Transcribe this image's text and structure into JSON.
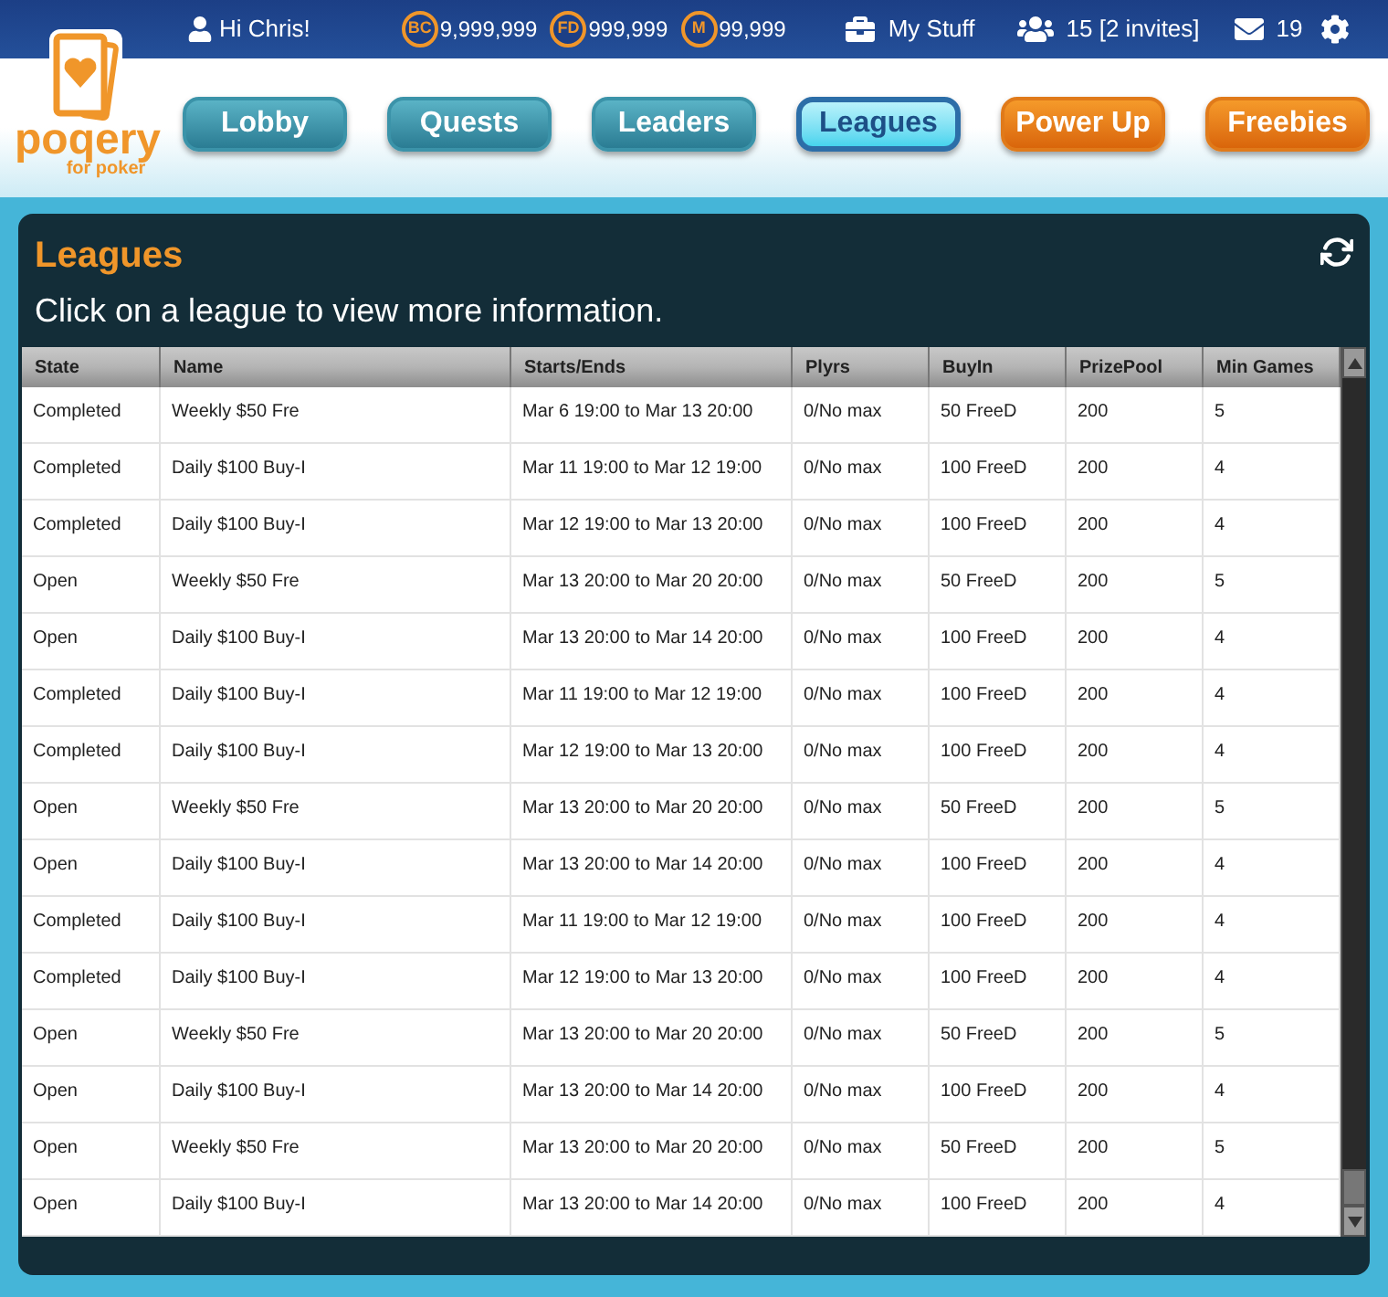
{
  "logo": {
    "name": "poqery",
    "tagline": "for poker"
  },
  "top_bar": {
    "greeting": "Hi Chris!",
    "currencies": [
      {
        "symbol": "BC",
        "amount": "9,999,999"
      },
      {
        "symbol": "FD",
        "amount": "999,999"
      },
      {
        "symbol": "M",
        "amount": "99,999"
      }
    ],
    "my_stuff": "My Stuff",
    "friends": "15 [2 invites]",
    "messages": "19"
  },
  "nav": [
    {
      "label": "Lobby",
      "kind": "teal",
      "selected": false
    },
    {
      "label": "Quests",
      "kind": "teal",
      "selected": false
    },
    {
      "label": "Leaders",
      "kind": "teal",
      "selected": false
    },
    {
      "label": "Leagues",
      "kind": "teal",
      "selected": true
    },
    {
      "label": "Power Up",
      "kind": "orange",
      "selected": false
    },
    {
      "label": "Freebies",
      "kind": "orange",
      "selected": false
    }
  ],
  "panel": {
    "title": "Leagues",
    "subtitle": "Click on a league to view more information."
  },
  "table": {
    "columns": [
      "State",
      "Name",
      "Starts/Ends",
      "Plyrs",
      "BuyIn",
      "PrizePool",
      "Min Games"
    ],
    "rows": [
      [
        "Completed",
        "Weekly $50 Fre",
        "Mar 6 19:00 to Mar 13 20:00",
        "0/No max",
        "50 FreeD",
        "200",
        "5"
      ],
      [
        "Completed",
        "Daily $100 Buy-I",
        "Mar 11 19:00 to Mar 12 19:00",
        "0/No max",
        "100 FreeD",
        "200",
        "4"
      ],
      [
        "Completed",
        "Daily $100 Buy-I",
        "Mar 12 19:00 to Mar 13 20:00",
        "0/No max",
        "100 FreeD",
        "200",
        "4"
      ],
      [
        "Open",
        "Weekly $50 Fre",
        "Mar 13 20:00 to Mar 20 20:00",
        "0/No max",
        "50 FreeD",
        "200",
        "5"
      ],
      [
        "Open",
        "Daily $100 Buy-I",
        "Mar 13 20:00 to Mar 14 20:00",
        "0/No max",
        "100 FreeD",
        "200",
        "4"
      ],
      [
        "Completed",
        "Daily $100 Buy-I",
        "Mar 11 19:00 to Mar 12 19:00",
        "0/No max",
        "100 FreeD",
        "200",
        "4"
      ],
      [
        "Completed",
        "Daily $100 Buy-I",
        "Mar 12 19:00 to Mar 13 20:00",
        "0/No max",
        "100 FreeD",
        "200",
        "4"
      ],
      [
        "Open",
        "Weekly $50 Fre",
        "Mar 13 20:00 to Mar 20 20:00",
        "0/No max",
        "50 FreeD",
        "200",
        "5"
      ],
      [
        "Open",
        "Daily $100 Buy-I",
        "Mar 13 20:00 to Mar 14 20:00",
        "0/No max",
        "100 FreeD",
        "200",
        "4"
      ],
      [
        "Completed",
        "Daily $100 Buy-I",
        "Mar 11 19:00 to Mar 12 19:00",
        "0/No max",
        "100 FreeD",
        "200",
        "4"
      ],
      [
        "Completed",
        "Daily $100 Buy-I",
        "Mar 12 19:00 to Mar 13 20:00",
        "0/No max",
        "100 FreeD",
        "200",
        "4"
      ],
      [
        "Open",
        "Weekly $50 Fre",
        "Mar 13 20:00 to Mar 20 20:00",
        "0/No max",
        "50 FreeD",
        "200",
        "5"
      ],
      [
        "Open",
        "Daily $100 Buy-I",
        "Mar 13 20:00 to Mar 14 20:00",
        "0/No max",
        "100 FreeD",
        "200",
        "4"
      ],
      [
        "Open",
        "Weekly $50 Fre",
        "Mar 13 20:00 to Mar 20 20:00",
        "0/No max",
        "50 FreeD",
        "200",
        "5"
      ],
      [
        "Open",
        "Daily $100 Buy-I",
        "Mar 13 20:00 to Mar 14 20:00",
        "0/No max",
        "100 FreeD",
        "200",
        "4"
      ]
    ]
  }
}
